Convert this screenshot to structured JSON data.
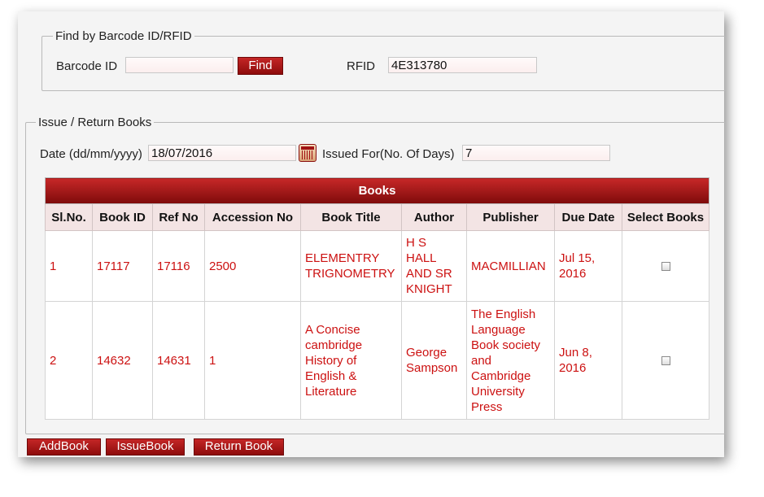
{
  "find_section": {
    "legend": "Find by Barcode ID/RFID",
    "barcode_label": "Barcode ID",
    "barcode_value": "",
    "find_button": "Find",
    "rfid_label": "RFID",
    "rfid_value": "4E313780"
  },
  "issue_section": {
    "legend": "Issue / Return Books",
    "date_label": "Date (dd/mm/yyyy)",
    "date_value": "18/07/2016",
    "days_label": "Issued For(No. Of Days)",
    "days_value": "7"
  },
  "books_table": {
    "caption": "Books",
    "columns": [
      "Sl.No.",
      "Book ID",
      "Ref No",
      "Accession No",
      "Book Title",
      "Author",
      "Publisher",
      "Due Date",
      "Select Books"
    ],
    "rows": [
      {
        "sl_no": "1",
        "book_id": "17117",
        "ref_no": "17116",
        "accession_no": "2500",
        "title_lines": [
          "ELEMENTRY",
          "TRIGNOMETRY"
        ],
        "author_lines": [
          "H S",
          "HALL",
          "AND SR",
          "KNIGHT"
        ],
        "publisher_lines": [
          "MACMILLIAN"
        ],
        "due_lines": [
          "Jul 15,",
          "2016"
        ],
        "selected": false
      },
      {
        "sl_no": "2",
        "book_id": "14632",
        "ref_no": "14631",
        "accession_no": "1",
        "title_lines": [
          "A Concise",
          "cambridge",
          "History of",
          "English &",
          "Literature"
        ],
        "author_lines": [
          "George",
          "Sampson"
        ],
        "publisher_lines": [
          "The English",
          "Language",
          "Book society",
          "and",
          "Cambridge",
          "University",
          "Press"
        ],
        "due_lines": [
          "Jun 8,",
          "2016"
        ],
        "selected": false
      }
    ]
  },
  "actions": {
    "add_book": "AddBook",
    "issue_book": "IssueBook",
    "return_book": "Return Book"
  },
  "colors": {
    "accent": "#b01818",
    "cell_text": "#cc1111",
    "header_bg": "#f3e4e4"
  }
}
